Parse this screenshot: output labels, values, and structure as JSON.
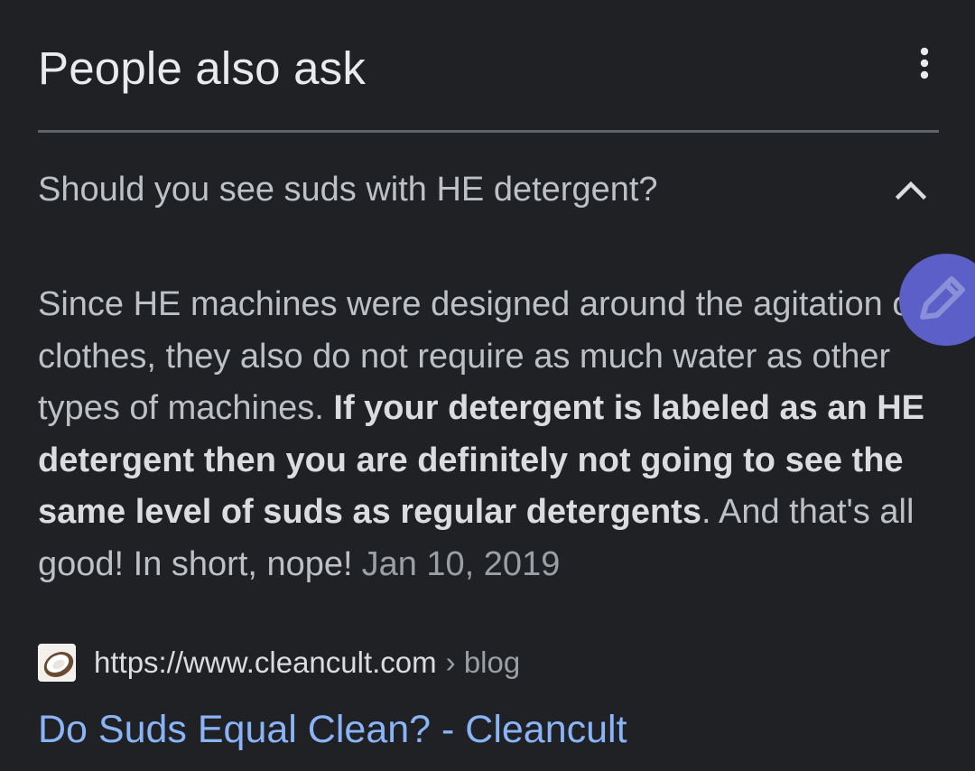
{
  "section": {
    "title": "People also ask",
    "more_icon": "more-vert-icon"
  },
  "question": {
    "text": "Should you see suds with HE detergent?",
    "state_icon": "chevron-up-icon"
  },
  "answer": {
    "intro": "Since HE machines were designed around the agitation of clothes, they also do not require as much water as other types of machines.",
    "highlight": "If your detergent is labeled as an HE detergent then you are definitely not going to see the same level of suds as regular detergents",
    "outro": ". And that's all good! In short, nope!",
    "date": "Jan 10, 2019"
  },
  "source": {
    "url": "https://www.cleancult.com",
    "path": "› blog",
    "favicon_icon": "coconut-favicon-icon"
  },
  "result": {
    "title": "Do Suds Equal Clean? - Cleancult"
  },
  "floating_button": {
    "icon": "edit-pencil-icon",
    "color": "#5b5fc7"
  },
  "colors": {
    "background": "#202124",
    "link": "#8ab4f8",
    "text": "#bdc1c6",
    "divider": "#5f6368"
  }
}
